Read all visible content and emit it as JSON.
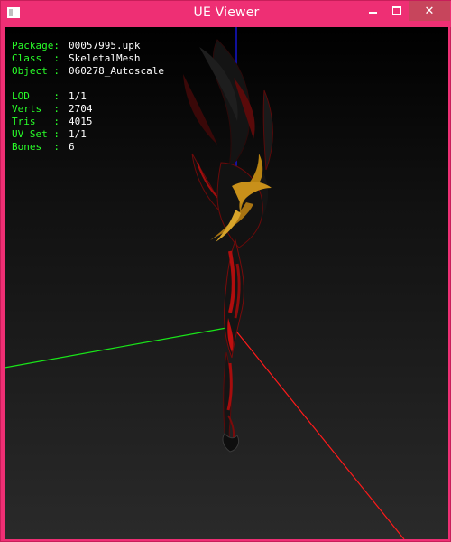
{
  "window": {
    "title": "UE Viewer",
    "icon": "app-icon",
    "controls": {
      "minimize": "minimize-icon",
      "maximize": "maximize-icon",
      "close": "✕"
    },
    "accent": "#ee2f74"
  },
  "info": {
    "package_label": "Package:",
    "package_value": "00057995.upk",
    "class_label": "Class  :",
    "class_value": "SkeletalMesh",
    "object_label": "Object :",
    "object_value": "060278_Autoscale",
    "lod_label": "LOD    :",
    "lod_value": "1/1",
    "verts_label": "Verts  :",
    "verts_value": "2704",
    "tris_label": "Tris   :",
    "tris_value": "4015",
    "uvset_label": "UV Set :",
    "uvset_value": "1/1",
    "bones_label": "Bones  :",
    "bones_value": "6"
  },
  "colors": {
    "label_text": "#29ff29",
    "value_text": "#ffffff",
    "axis_x": "#ff1a1a",
    "axis_y": "#19e619",
    "axis_z": "#1a1aff"
  }
}
